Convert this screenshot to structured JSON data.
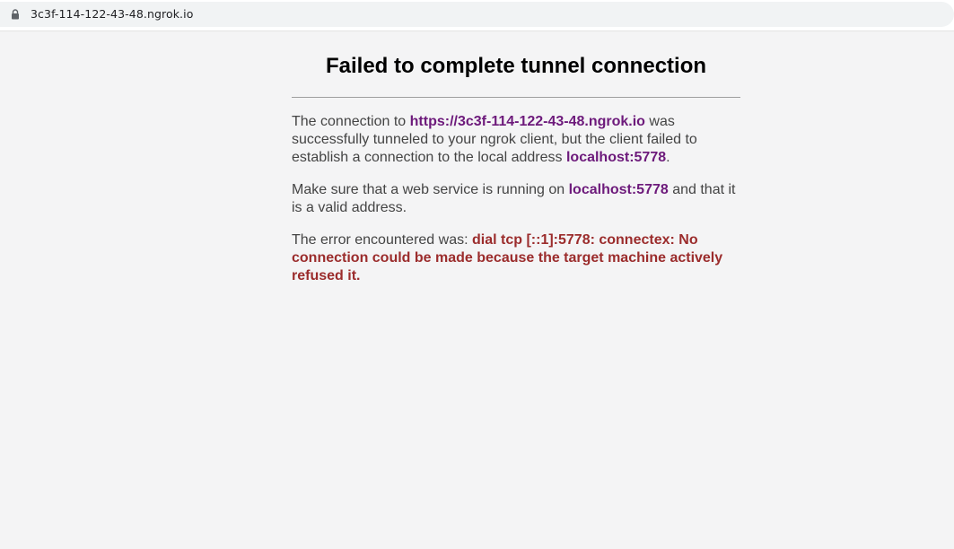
{
  "browser": {
    "url": "3c3f-114-122-43-48.ngrok.io"
  },
  "page": {
    "title": "Failed to complete tunnel connection",
    "p1": {
      "before": "The connection to ",
      "tunnel_url": "https://3c3f-114-122-43-48.ngrok.io",
      "middle": " was successfully tunneled to your ngrok client, but the client failed to establish a connection to the local address ",
      "local_address": "localhost:5778",
      "after": "."
    },
    "p2": {
      "before": "Make sure that a web service is running on ",
      "local_address": "localhost:5778",
      "after": " and that it is a valid address."
    },
    "p3": {
      "before": "The error encountered was: ",
      "error": "dial tcp [::1]:5778: connectex: No connection could be made because the target machine actively refused it."
    }
  },
  "colors": {
    "highlight": "#6d1a7b",
    "error": "#9b2c2c",
    "text": "#444444",
    "background": "#f4f4f5"
  }
}
